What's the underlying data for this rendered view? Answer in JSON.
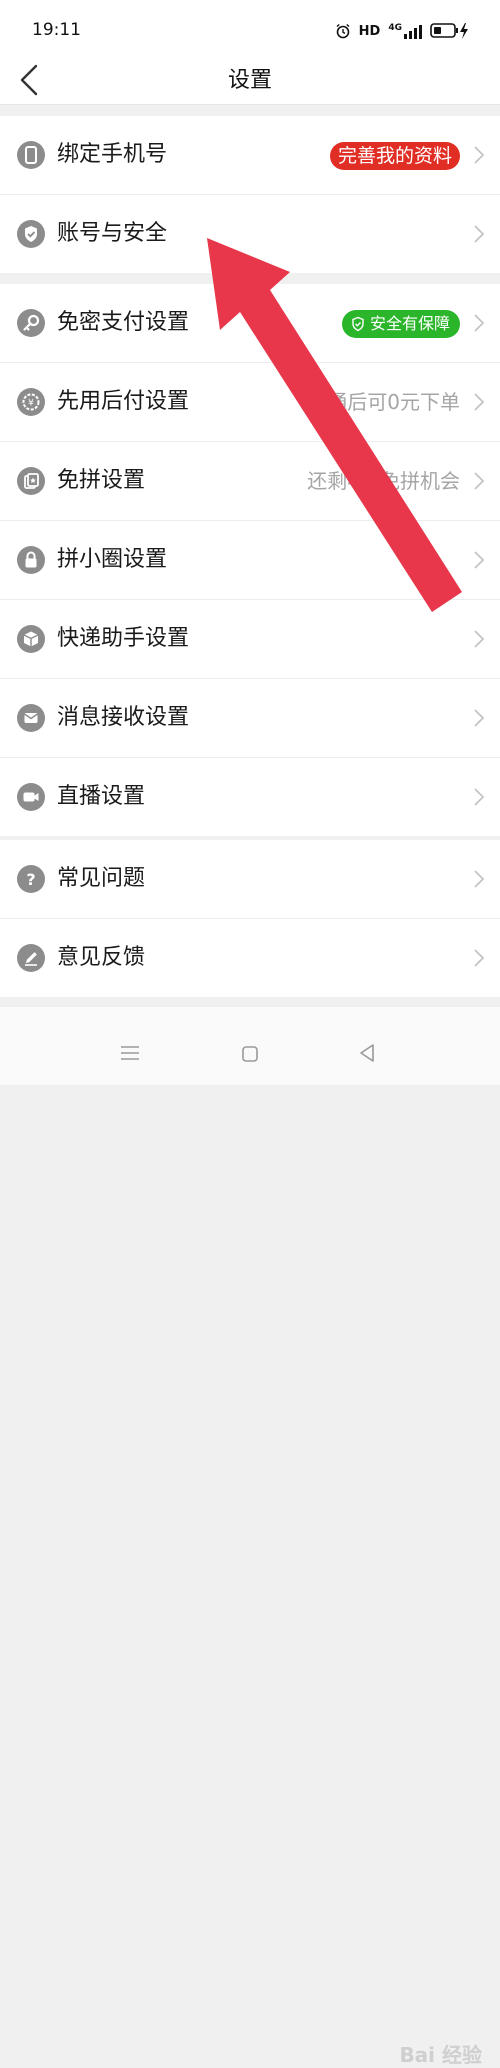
{
  "status": {
    "time": "19:11",
    "hd": "HD",
    "signal_label": "4G"
  },
  "header": {
    "title": "设置"
  },
  "groups": {
    "account": [
      {
        "label": "绑定手机号",
        "badge": "完善我的资料",
        "icon": "phone-icon"
      },
      {
        "label": "账号与安全",
        "icon": "shield-icon"
      }
    ],
    "settings": [
      {
        "label": "免密支付设置",
        "badge": "安全有保障",
        "icon": "key-icon"
      },
      {
        "label": "先用后付设置",
        "value": "开通后可0元下单",
        "icon": "clock-coin-icon"
      },
      {
        "label": "免拼设置",
        "value": "还剩4次免拼机会",
        "icon": "card-icon"
      },
      {
        "label": "拼小圈设置",
        "icon": "lock-icon"
      },
      {
        "label": "快递助手设置",
        "icon": "package-icon"
      },
      {
        "label": "消息接收设置",
        "icon": "mail-icon"
      },
      {
        "label": "直播设置",
        "icon": "video-icon"
      }
    ],
    "help": [
      {
        "label": "常见问题",
        "icon": "question-icon"
      },
      {
        "label": "意见反馈",
        "icon": "pencil-icon"
      }
    ]
  },
  "watermark": "Bai 经验",
  "colors": {
    "accent_red": "#e02e24",
    "accent_green": "#2bb52b",
    "arrow": "#e8374a"
  }
}
